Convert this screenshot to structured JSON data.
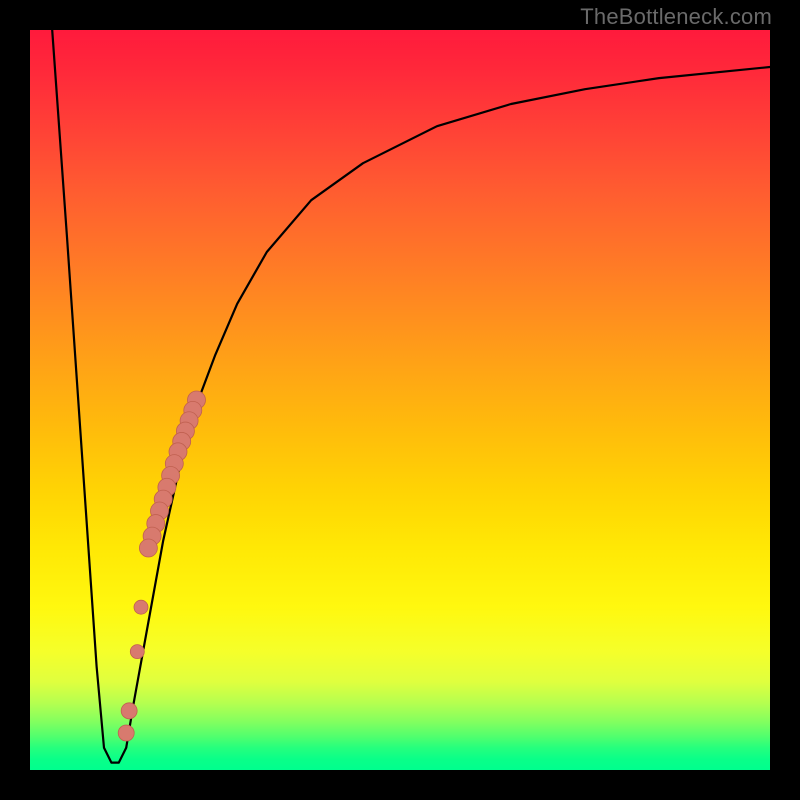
{
  "watermark": {
    "text": "TheBottleneck.com"
  },
  "colors": {
    "curve": "#000000",
    "marker": "#d87a6e",
    "marker_stroke": "#c06050"
  },
  "chart_data": {
    "type": "line",
    "title": "",
    "xlabel": "",
    "ylabel": "",
    "xlim": [
      0,
      100
    ],
    "ylim": [
      0,
      100
    ],
    "grid": false,
    "legend": false,
    "series": [
      {
        "name": "curve",
        "x": [
          3,
          5,
          7,
          9,
          10,
          11,
          12,
          13,
          14,
          16,
          18,
          20,
          22,
          25,
          28,
          32,
          38,
          45,
          55,
          65,
          75,
          85,
          95,
          100
        ],
        "y": [
          100,
          72,
          43,
          14,
          3,
          1,
          1,
          3,
          9,
          20,
          31,
          40,
          48,
          56,
          63,
          70,
          77,
          82,
          87,
          90,
          92,
          93.5,
          94.5,
          95
        ]
      }
    ],
    "markers": [
      {
        "name": "streak-top",
        "x": 22.5,
        "y": 50.0,
        "r": 9
      },
      {
        "name": "streak-1",
        "x": 22.0,
        "y": 48.6,
        "r": 9
      },
      {
        "name": "streak-2",
        "x": 21.5,
        "y": 47.2,
        "r": 9
      },
      {
        "name": "streak-3",
        "x": 21.0,
        "y": 45.8,
        "r": 9
      },
      {
        "name": "streak-4",
        "x": 20.5,
        "y": 44.4,
        "r": 9
      },
      {
        "name": "streak-5",
        "x": 20.0,
        "y": 43.0,
        "r": 9
      },
      {
        "name": "streak-6",
        "x": 19.5,
        "y": 41.4,
        "r": 9
      },
      {
        "name": "streak-7",
        "x": 19.0,
        "y": 39.8,
        "r": 9
      },
      {
        "name": "streak-8",
        "x": 18.5,
        "y": 38.2,
        "r": 9
      },
      {
        "name": "streak-9",
        "x": 18.0,
        "y": 36.6,
        "r": 9
      },
      {
        "name": "streak-10",
        "x": 17.5,
        "y": 35.0,
        "r": 9
      },
      {
        "name": "streak-11",
        "x": 17.0,
        "y": 33.3,
        "r": 9
      },
      {
        "name": "streak-12",
        "x": 16.5,
        "y": 31.6,
        "r": 9
      },
      {
        "name": "streak-bottom",
        "x": 16.0,
        "y": 30.0,
        "r": 9
      },
      {
        "name": "dot-mid-gap",
        "x": 15.0,
        "y": 22.0,
        "r": 7
      },
      {
        "name": "dot-low-gap",
        "x": 14.5,
        "y": 16.0,
        "r": 7
      },
      {
        "name": "pair-low-1",
        "x": 13.4,
        "y": 8.0,
        "r": 8
      },
      {
        "name": "pair-low-2",
        "x": 13.0,
        "y": 5.0,
        "r": 8
      }
    ]
  }
}
